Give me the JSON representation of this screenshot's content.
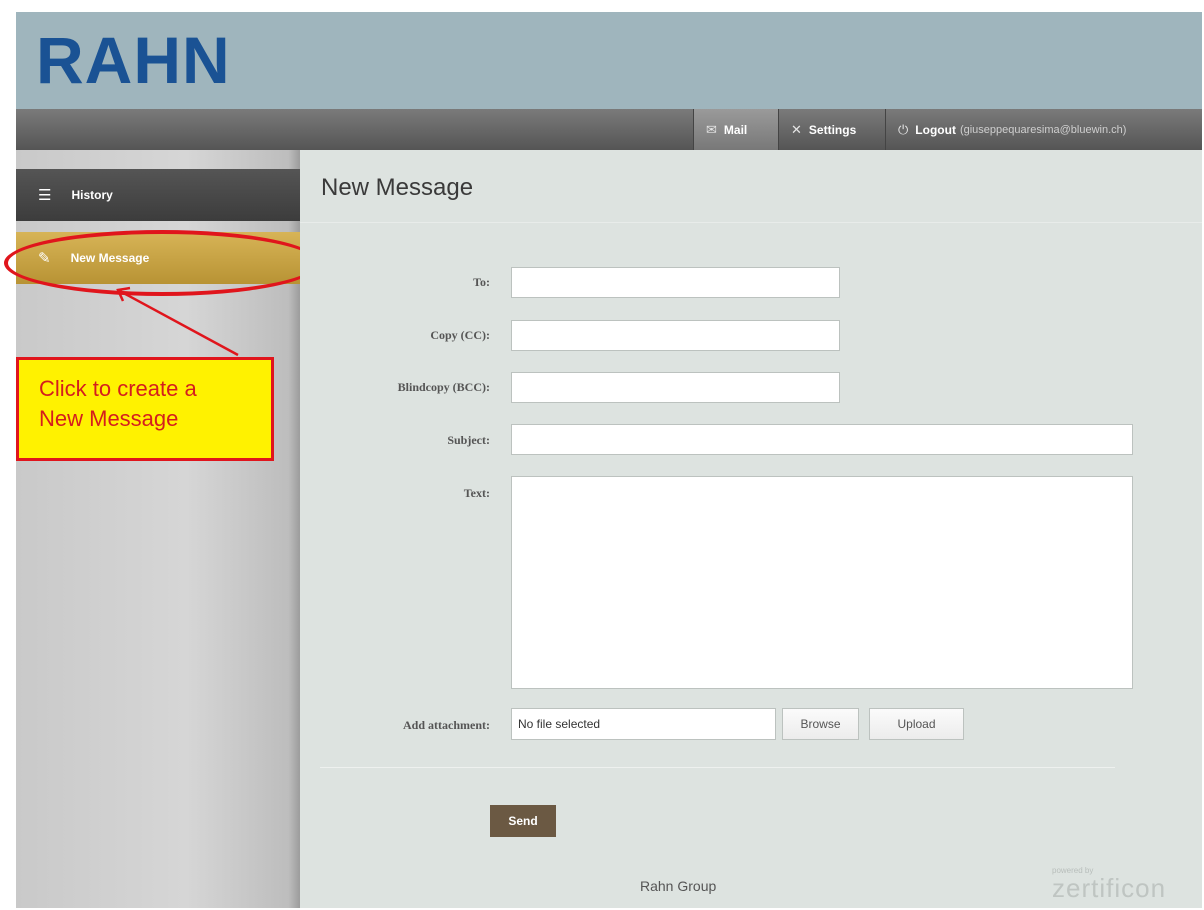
{
  "header": {
    "logo": "RAHN"
  },
  "nav": {
    "mail": "Mail",
    "settings": "Settings",
    "logout": "Logout",
    "email": "(giuseppequaresima@bluewin.ch)"
  },
  "sidebar": {
    "items": [
      {
        "label": "History",
        "icon": "list-icon"
      },
      {
        "label": "New Message",
        "icon": "edit-icon"
      }
    ]
  },
  "callout": {
    "line1": "Click to create a",
    "line2": "New Message"
  },
  "main": {
    "title": "New Message",
    "form": {
      "to_label": "To:",
      "cc_label": "Copy (CC):",
      "bcc_label": "Blindcopy (BCC):",
      "subject_label": "Subject:",
      "text_label": "Text:",
      "attachment_label": "Add attachment:",
      "file_status": "No file selected",
      "browse": "Browse",
      "upload": "Upload",
      "send": "Send"
    },
    "footer": "Rahn Group",
    "powered_by": "powered by",
    "brand": "zertificon"
  },
  "colors": {
    "header_bg": "#9fb5bd",
    "logo": "#1a5294",
    "active_sidebar": "#c9a544",
    "send_button": "#6b5943",
    "callout_bg": "#fff200",
    "callout_border": "#e0151c"
  }
}
